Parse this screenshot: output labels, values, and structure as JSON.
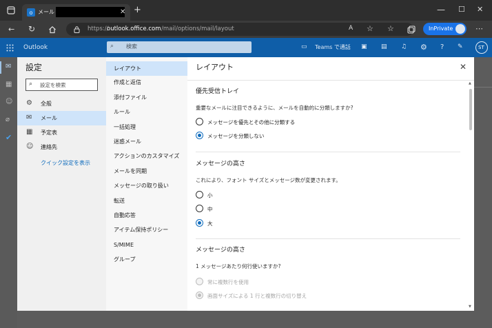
{
  "browser": {
    "tab_title": "メール -",
    "url_prefix": "https://",
    "url_host": "outlook.office.com",
    "url_path": "/mail/options/mail/layout",
    "inprivate_label": "InPrivate"
  },
  "outlook": {
    "app_name": "Outlook",
    "search_placeholder": "検索",
    "teams_label": "Teams で通話",
    "avatar_initials": "ST"
  },
  "settings": {
    "title": "設定",
    "search_placeholder": "設定を検索",
    "categories": [
      {
        "label": "全般",
        "icon": "gear-icon"
      },
      {
        "label": "メール",
        "icon": "mail-icon"
      },
      {
        "label": "予定表",
        "icon": "calendar-icon"
      },
      {
        "label": "連絡先",
        "icon": "contacts-icon"
      }
    ],
    "quick_settings_link": "クイック設定を表示",
    "submenu": [
      "レイアウト",
      "作成と返信",
      "添付ファイル",
      "ルール",
      "一括処理",
      "迷惑メール",
      "アクションのカスタマイズ",
      "メールを同期",
      "メッセージの取り扱い",
      "転送",
      "自動応答",
      "アイテム保持ポリシー",
      "S/MIME",
      "グループ"
    ],
    "panel_title": "レイアウト",
    "sections": [
      {
        "heading": "優先受信トレイ",
        "question": "重要なメールに注目できるように、メールを自動的に分類しますか?",
        "options": [
          {
            "label": "メッセージを優先とその他に分類する",
            "checked": false
          },
          {
            "label": "メッセージを分類しない",
            "checked": true
          }
        ]
      },
      {
        "heading": "メッセージの高さ",
        "question": "これにより、フォント サイズとメッセージ数が変更されます。",
        "options": [
          {
            "label": "小",
            "checked": false
          },
          {
            "label": "中",
            "checked": false
          },
          {
            "label": "大",
            "checked": true
          }
        ]
      },
      {
        "heading": "メッセージの高さ",
        "question": "1 メッセージあたり何行使いますか?",
        "options": [
          {
            "label": "常に複数行を使用",
            "checked": false,
            "disabled": true
          },
          {
            "label": "画面サイズによる 1 行と複数行の切り替え",
            "checked": true,
            "disabled": true
          }
        ]
      }
    ]
  },
  "colors": {
    "accent": "#0f6cbd",
    "header": "#0f5ea8",
    "selected": "#cfe4fa"
  }
}
